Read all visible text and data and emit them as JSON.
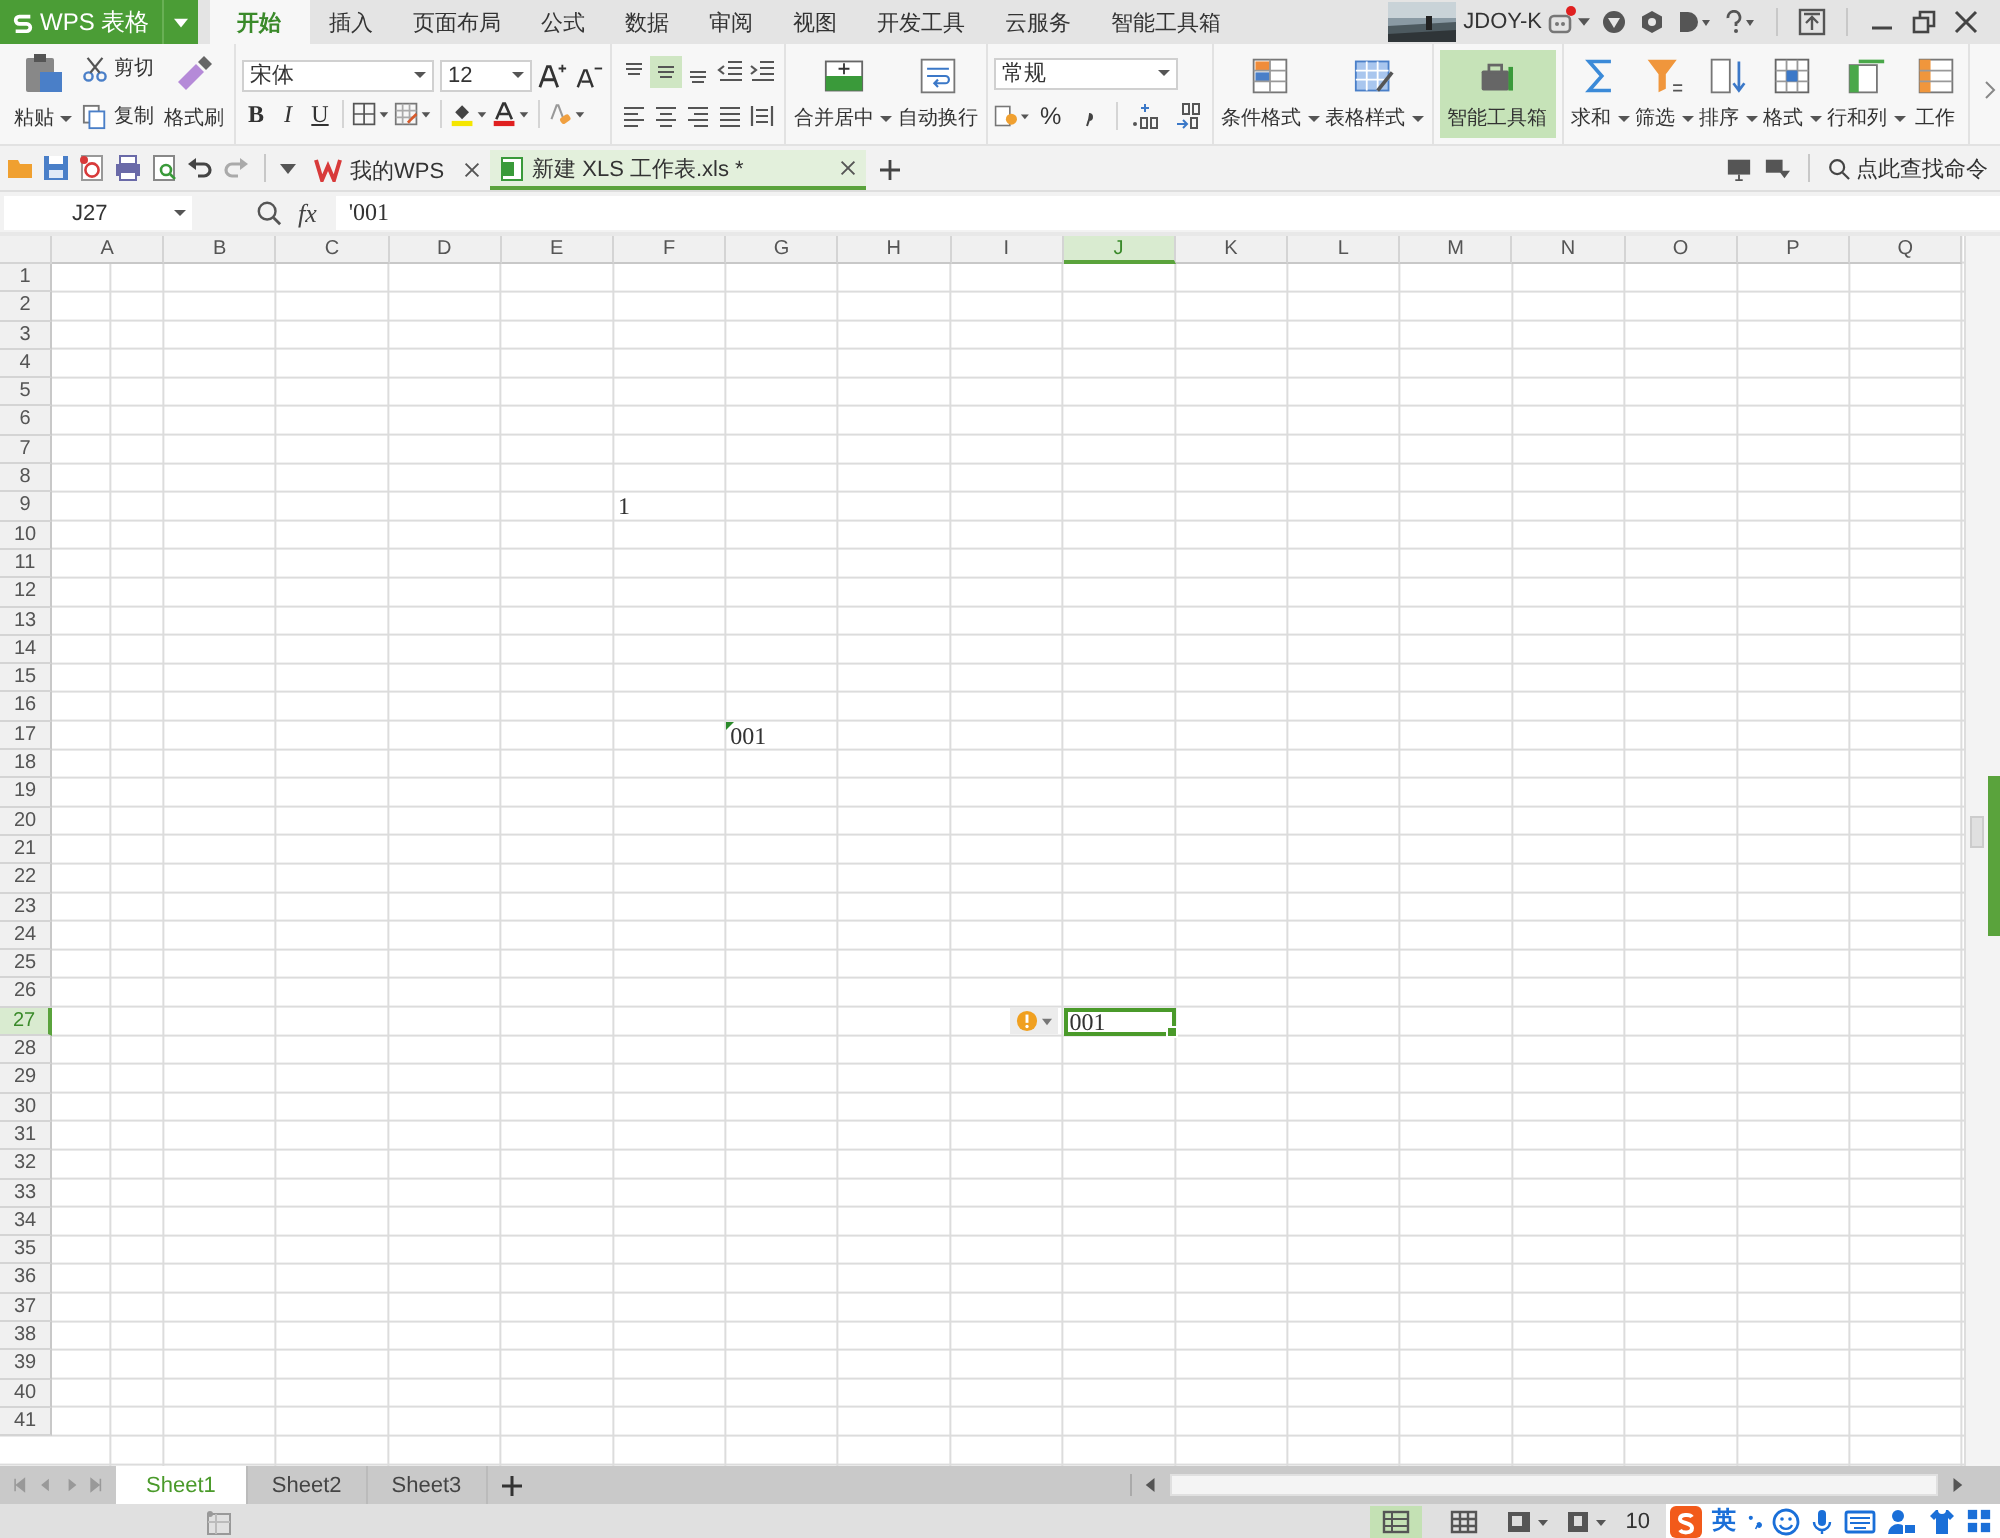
{
  "app": {
    "title": "WPS 表格"
  },
  "menu_tabs": [
    {
      "label": "开始",
      "selected": true
    },
    {
      "label": "插入",
      "selected": false
    },
    {
      "label": "页面布局",
      "selected": false
    },
    {
      "label": "公式",
      "selected": false
    },
    {
      "label": "数据",
      "selected": false
    },
    {
      "label": "审阅",
      "selected": false
    },
    {
      "label": "视图",
      "selected": false
    },
    {
      "label": "开发工具",
      "selected": false
    },
    {
      "label": "云服务",
      "selected": false
    },
    {
      "label": "智能工具箱",
      "selected": false
    }
  ],
  "account": {
    "user": "JDOY-K",
    "notification": true
  },
  "ribbon": {
    "clipboard": [
      {
        "label": "粘贴",
        "kind": "paste",
        "dropdown": true
      },
      {
        "label": "剪切",
        "kind": "cut"
      },
      {
        "label": "复制",
        "kind": "copy"
      },
      {
        "label": "格式刷",
        "kind": "painter"
      }
    ],
    "font": {
      "name": "宋体",
      "size": "12"
    },
    "text_styles": [
      "B",
      "I",
      "U"
    ],
    "number_format": "常规",
    "percent": "%",
    "command_groups": [
      [
        {
          "label": "合并居中",
          "kind": "merge",
          "dropdown": true,
          "selected": false
        },
        {
          "label": "自动换行",
          "kind": "wrap",
          "dropdown": false,
          "selected": false
        }
      ],
      [
        {
          "label": "条件格式",
          "kind": "conditional",
          "dropdown": true,
          "selected": false
        },
        {
          "label": "表格样式",
          "kind": "table_style",
          "dropdown": true,
          "selected": false
        }
      ],
      [
        {
          "label": "智能工具箱",
          "kind": "toolbox",
          "dropdown": false,
          "selected": true
        }
      ],
      [
        {
          "label": "求和",
          "kind": "sum",
          "dropdown": true,
          "selected": false
        },
        {
          "label": "筛选",
          "kind": "filter",
          "dropdown": true,
          "selected": false
        },
        {
          "label": "排序",
          "kind": "sort",
          "dropdown": true,
          "selected": false
        },
        {
          "label": "格式",
          "kind": "format",
          "dropdown": true,
          "selected": false
        },
        {
          "label": "行和列",
          "kind": "rows_columns",
          "dropdown": true,
          "selected": false
        },
        {
          "label": "工作",
          "kind": "worksheet",
          "dropdown": false,
          "selected": false
        }
      ]
    ]
  },
  "doc_tabs": [
    {
      "label": "我的WPS",
      "kind": "home",
      "selected": false
    },
    {
      "label": "新建 XLS 工作表.xls *",
      "kind": "spreadsheet",
      "selected": true
    }
  ],
  "command_search": {
    "placeholder": "点此查找命令"
  },
  "formula_bar": {
    "cell_ref": "J27",
    "function_label": "fx",
    "content": "'001"
  },
  "sheet": {
    "columns": [
      {
        "label": "A",
        "selected": false
      },
      {
        "label": "B",
        "selected": false
      },
      {
        "label": "C",
        "selected": false
      },
      {
        "label": "D",
        "selected": false
      },
      {
        "label": "E",
        "selected": false
      },
      {
        "label": "F",
        "selected": false
      },
      {
        "label": "G",
        "selected": false
      },
      {
        "label": "H",
        "selected": false
      },
      {
        "label": "I",
        "selected": false
      },
      {
        "label": "J",
        "selected": true
      },
      {
        "label": "K",
        "selected": false
      },
      {
        "label": "L",
        "selected": false
      },
      {
        "label": "M",
        "selected": false
      },
      {
        "label": "N",
        "selected": false
      },
      {
        "label": "O",
        "selected": false
      },
      {
        "label": "P",
        "selected": false
      },
      {
        "label": "Q",
        "selected": false
      }
    ],
    "rows": [
      {
        "header": "1",
        "selected": false
      },
      {
        "header": "2",
        "selected": false
      },
      {
        "header": "3",
        "selected": false
      },
      {
        "header": "4",
        "selected": false
      },
      {
        "header": "5",
        "selected": false
      },
      {
        "header": "6",
        "selected": false
      },
      {
        "header": "7",
        "selected": false
      },
      {
        "header": "8",
        "selected": false
      },
      {
        "header": "9",
        "selected": false,
        "cells": [
          null,
          null,
          null,
          null,
          null,
          {
            "value": "1",
            "error_flag": false,
            "warning_button": false,
            "selected": false
          }
        ]
      },
      {
        "header": "10",
        "selected": false
      },
      {
        "header": "11",
        "selected": false
      },
      {
        "header": "12",
        "selected": false
      },
      {
        "header": "13",
        "selected": false
      },
      {
        "header": "14",
        "selected": false
      },
      {
        "header": "15",
        "selected": false
      },
      {
        "header": "16",
        "selected": false
      },
      {
        "header": "17",
        "selected": false,
        "cells": [
          null,
          null,
          null,
          null,
          null,
          null,
          {
            "value": "001",
            "error_flag": true,
            "warning_button": false,
            "selected": false
          }
        ]
      },
      {
        "header": "18",
        "selected": false
      },
      {
        "header": "19",
        "selected": false
      },
      {
        "header": "20",
        "selected": false
      },
      {
        "header": "21",
        "selected": false
      },
      {
        "header": "22",
        "selected": false
      },
      {
        "header": "23",
        "selected": false
      },
      {
        "header": "24",
        "selected": false
      },
      {
        "header": "25",
        "selected": false
      },
      {
        "header": "26",
        "selected": false
      },
      {
        "header": "27",
        "selected": true,
        "cells": [
          null,
          null,
          null,
          null,
          null,
          null,
          null,
          null,
          null,
          {
            "value": "001",
            "error_flag": false,
            "warning_button": true,
            "selected": true
          }
        ]
      },
      {
        "header": "28",
        "selected": false
      },
      {
        "header": "29",
        "selected": false
      },
      {
        "header": "30",
        "selected": false
      },
      {
        "header": "31",
        "selected": false
      },
      {
        "header": "32",
        "selected": false
      },
      {
        "header": "33",
        "selected": false
      },
      {
        "header": "34",
        "selected": false
      },
      {
        "header": "35",
        "selected": false
      },
      {
        "header": "36",
        "selected": false
      },
      {
        "header": "37",
        "selected": false
      },
      {
        "header": "38",
        "selected": false
      },
      {
        "header": "39",
        "selected": false
      },
      {
        "header": "40",
        "selected": false
      },
      {
        "header": "41",
        "selected": false
      }
    ]
  },
  "sheet_tabs": [
    {
      "label": "Sheet1",
      "selected": true
    },
    {
      "label": "Sheet2",
      "selected": false
    },
    {
      "label": "Sheet3",
      "selected": false
    }
  ],
  "status_bar": {
    "views": [
      {
        "kind": "normal",
        "selected": true
      },
      {
        "kind": "page_break",
        "selected": false
      }
    ],
    "zoom": "10"
  },
  "ime": {
    "mode": "英"
  }
}
